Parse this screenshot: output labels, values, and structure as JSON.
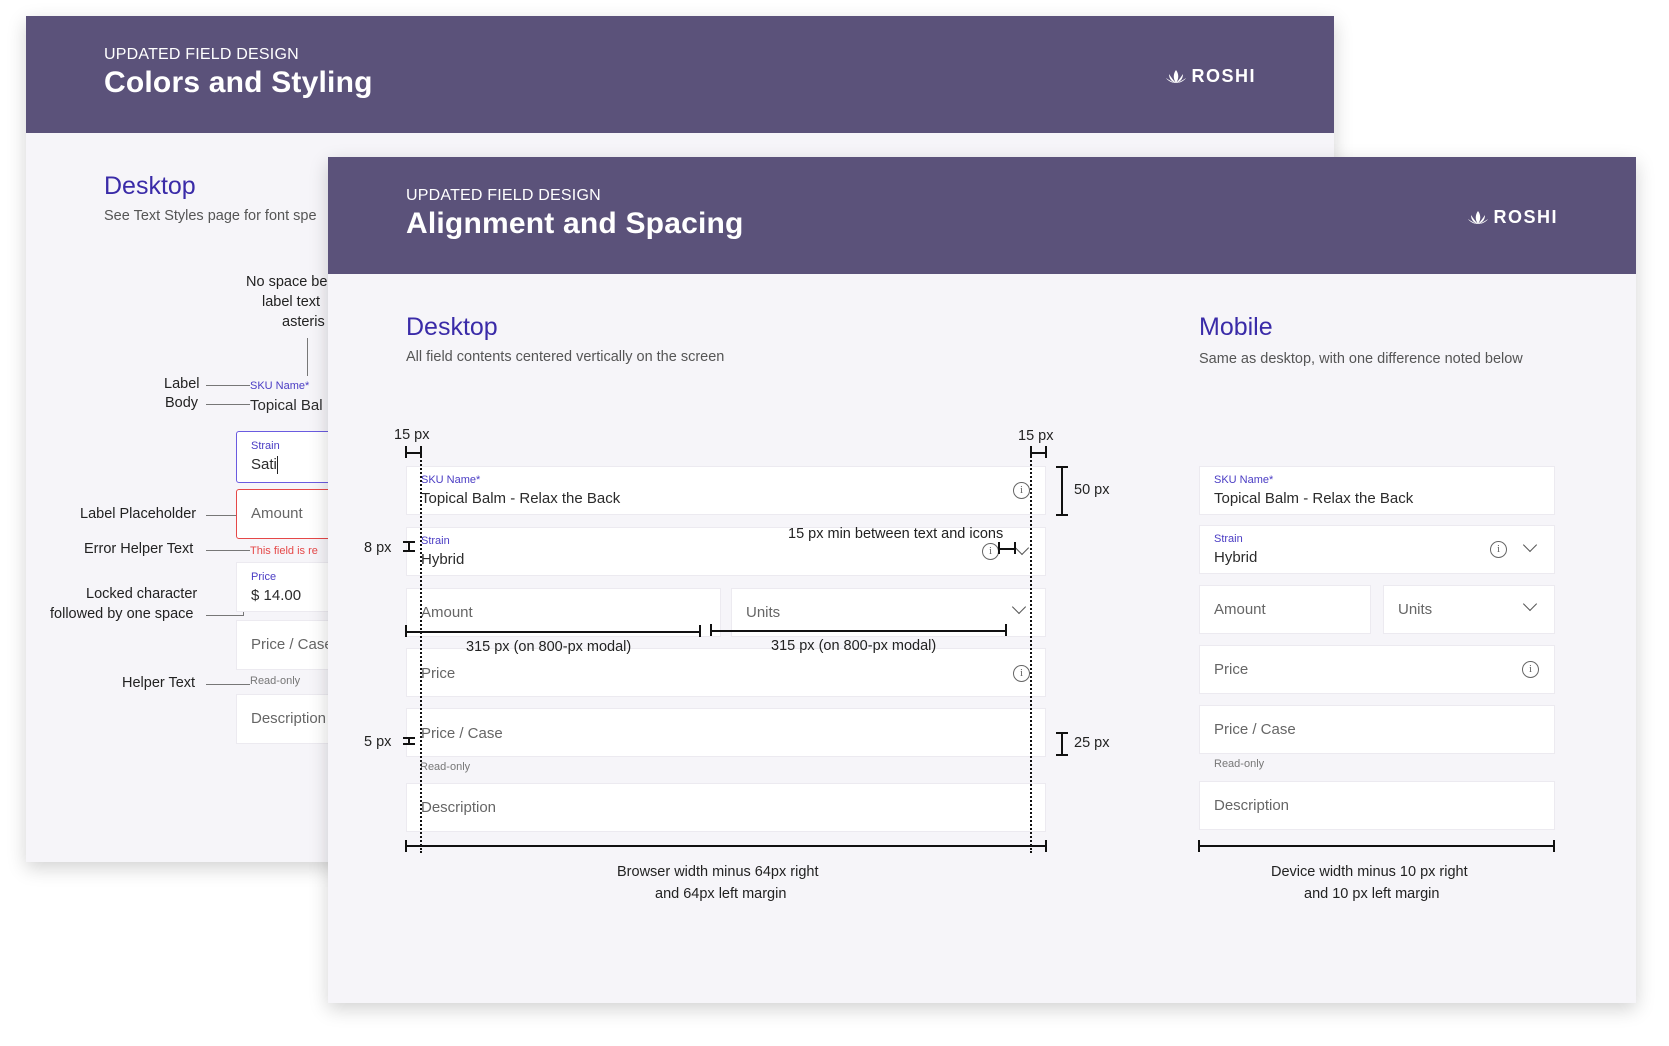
{
  "back_card": {
    "kicker": "UPDATED FIELD DESIGN",
    "title": "Colors and Styling",
    "logo": "ROSHI",
    "section_title": "Desktop",
    "section_sub": "See Text Styles page for font spe",
    "annotations": {
      "no_space": [
        "No space be",
        "label text",
        "asteris"
      ],
      "label": "Label",
      "body": "Body",
      "label_placeholder": "Label Placeholder",
      "error_helper": "Error Helper Text",
      "locked_char": [
        "Locked character",
        "followed by one space"
      ],
      "helper_text": "Helper Text"
    },
    "fields": {
      "sku_label": "SKU Name*",
      "sku_body": "Topical Bal",
      "strain_label": "Strain",
      "strain_body": "Sati",
      "amount_placeholder": "Amount",
      "error_text": "This field is re",
      "price_label": "Price",
      "price_body": "$ 14.00",
      "price_case": "Price / Case",
      "read_only": "Read-only",
      "description": "Description"
    }
  },
  "front_card": {
    "kicker": "UPDATED FIELD DESIGN",
    "title": "Alignment and Spacing",
    "logo": "ROSHI",
    "desktop": {
      "title": "Desktop",
      "subtitle": "All field contents centered vertically on the screen",
      "fields": {
        "sku_label": "SKU Name*",
        "sku_body": "Topical Balm - Relax the Back",
        "strain_label": "Strain",
        "strain_body": "Hybrid",
        "amount": "Amount",
        "units": "Units",
        "price": "Price",
        "price_case": "Price / Case",
        "read_only": "Read-only",
        "description": "Description"
      },
      "measurements": {
        "left_padding": "15 px",
        "right_padding": "15 px",
        "field_height": "50 px",
        "text_icon_gap": "15 px min between text and icons",
        "label_gap": "8 px",
        "half_width_left": "315 px (on 800-px modal)",
        "half_width_right": "315 px (on 800-px modal)",
        "helper_gap": "5 px",
        "field_spacing": "25 px",
        "width_note": [
          "Browser width minus 64px right",
          "and 64px left margin"
        ]
      }
    },
    "mobile": {
      "title": "Mobile",
      "subtitle": "Same as desktop, with one difference noted below",
      "fields": {
        "sku_label": "SKU Name*",
        "sku_body": "Topical Balm - Relax the Back",
        "strain_label": "Strain",
        "strain_body": "Hybrid",
        "amount": "Amount",
        "units": "Units",
        "price": "Price",
        "price_case": "Price / Case",
        "read_only": "Read-only",
        "description": "Description"
      },
      "width_note": [
        "Device width minus 10 px right",
        "and 10 px left margin"
      ]
    }
  },
  "colors": {
    "banner": "#5b527a",
    "heading": "#3a2ba8",
    "label": "#4a3cc4",
    "error": "#e54848",
    "focus": "#6a5be0"
  }
}
